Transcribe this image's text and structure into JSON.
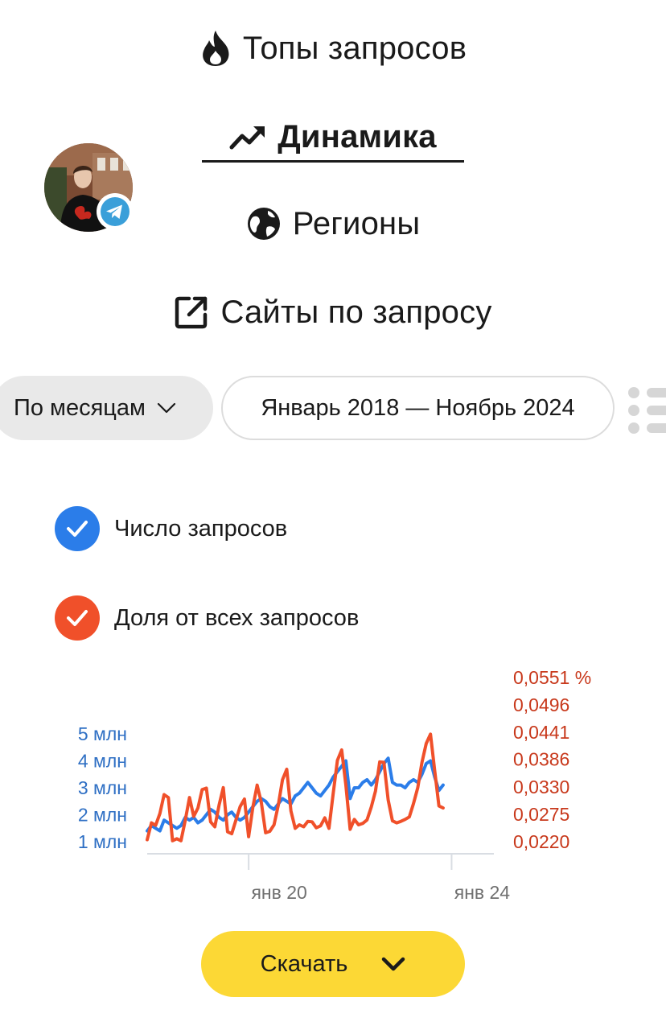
{
  "nav": {
    "tops": {
      "label": "Топы запросов"
    },
    "dynamics": {
      "label": "Динамика"
    },
    "regions": {
      "label": "Регионы"
    },
    "sites": {
      "label": "Сайты по запросу"
    }
  },
  "filters": {
    "period": "По месяцам",
    "range": "Январь 2018 — Ноябрь 2024"
  },
  "legend": {
    "count": {
      "label": "Число запросов",
      "color": "#2b7de9"
    },
    "share": {
      "label": "Доля от всех запросов",
      "color": "#f0502a"
    }
  },
  "chart_data": {
    "type": "line",
    "x_ticks": [
      "янв 20",
      "янв 24"
    ],
    "y_left_ticks": [
      "5 млн",
      "4 млн",
      "3 млн",
      "2 млн",
      "1 млн"
    ],
    "y_left_tick_values": [
      5,
      4,
      3,
      2,
      1
    ],
    "y_right_ticks": [
      "0,0551 %",
      "0,0496",
      "0,0441",
      "0,0386",
      "0,0330",
      "0,0275",
      "0,0220"
    ],
    "y_right_tick_values": [
      0.0551,
      0.0496,
      0.0441,
      0.0386,
      0.033,
      0.0275,
      0.022
    ],
    "x_start": "2018-01",
    "x_end": "2024-11",
    "series": [
      {
        "name": "Число запросов",
        "axis": "left",
        "color": "#2b7de9",
        "values": [
          1.4,
          1.6,
          1.5,
          1.4,
          1.8,
          1.7,
          1.6,
          1.5,
          1.6,
          1.9,
          1.8,
          1.9,
          1.7,
          1.8,
          2.0,
          2.2,
          2.1,
          1.9,
          1.8,
          2.0,
          2.1,
          1.9,
          1.8,
          1.9,
          2.1,
          2.3,
          2.5,
          2.6,
          2.5,
          2.3,
          2.2,
          2.4,
          2.6,
          2.5,
          2.4,
          2.7,
          2.8,
          3.0,
          3.2,
          3.0,
          2.8,
          2.7,
          2.9,
          3.1,
          3.4,
          3.6,
          3.8,
          4.0,
          2.6,
          3.0,
          3.0,
          3.2,
          3.3,
          3.1,
          3.3,
          3.6,
          3.9,
          4.1,
          3.2,
          3.1,
          3.1,
          3.0,
          3.2,
          3.3,
          3.2,
          3.5,
          3.9,
          4.0,
          3.4,
          2.9,
          3.1
        ]
      },
      {
        "name": "Доля от всех запросов",
        "axis": "right",
        "color": "#f0502a",
        "values": [
          0.0224,
          0.0258,
          0.0253,
          0.0277,
          0.0315,
          0.0309,
          0.0222,
          0.0226,
          0.0222,
          0.0263,
          0.0309,
          0.0271,
          0.0288,
          0.0325,
          0.0328,
          0.026,
          0.025,
          0.0294,
          0.0329,
          0.024,
          0.0236,
          0.0264,
          0.0291,
          0.0306,
          0.023,
          0.029,
          0.0334,
          0.0299,
          0.0238,
          0.0241,
          0.0254,
          0.0293,
          0.0345,
          0.0366,
          0.0282,
          0.0247,
          0.0254,
          0.025,
          0.0261,
          0.026,
          0.0248,
          0.0252,
          0.0268,
          0.0247,
          0.0318,
          0.0384,
          0.0405,
          0.0334,
          0.0245,
          0.0265,
          0.0254,
          0.0257,
          0.0264,
          0.029,
          0.0322,
          0.0381,
          0.038,
          0.0304,
          0.0262,
          0.0258,
          0.0261,
          0.0265,
          0.027,
          0.0297,
          0.0329,
          0.038,
          0.0418,
          0.0437,
          0.0364,
          0.0292,
          0.0288
        ]
      }
    ]
  },
  "download": {
    "label": "Скачать"
  }
}
